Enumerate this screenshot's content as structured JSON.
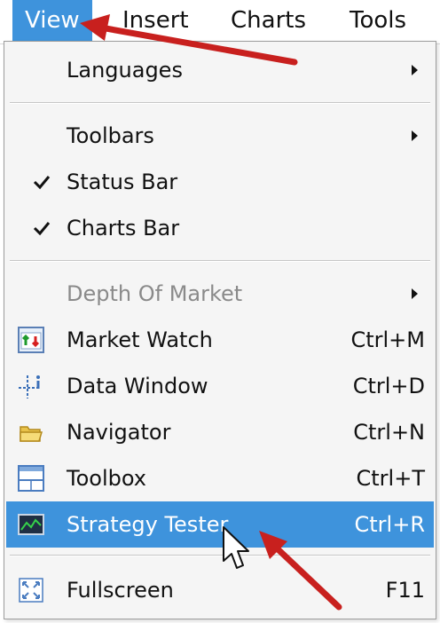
{
  "menubar": {
    "items": [
      {
        "label": "View"
      },
      {
        "label": "Insert"
      },
      {
        "label": "Charts"
      },
      {
        "label": "Tools"
      }
    ]
  },
  "menu": {
    "languages": {
      "label": "Languages"
    },
    "toolbars": {
      "label": "Toolbars"
    },
    "status_bar": {
      "label": "Status Bar",
      "checked": true
    },
    "charts_bar": {
      "label": "Charts Bar",
      "checked": true
    },
    "depth_of_market": {
      "label": "Depth Of Market",
      "disabled": true
    },
    "market_watch": {
      "label": "Market Watch",
      "shortcut": "Ctrl+M",
      "icon": "market-watch-icon"
    },
    "data_window": {
      "label": "Data Window",
      "shortcut": "Ctrl+D",
      "icon": "data-window-icon"
    },
    "navigator": {
      "label": "Navigator",
      "shortcut": "Ctrl+N",
      "icon": "navigator-folder-icon"
    },
    "toolbox": {
      "label": "Toolbox",
      "shortcut": "Ctrl+T",
      "icon": "toolbox-icon"
    },
    "strategy_tester": {
      "label": "Strategy Tester",
      "shortcut": "Ctrl+R",
      "icon": "strategy-tester-icon",
      "highlighted": true
    },
    "fullscreen": {
      "label": "Fullscreen",
      "shortcut": "F11",
      "icon": "fullscreen-icon"
    }
  },
  "colors": {
    "highlight": "#3e93dc",
    "annotation_arrow": "#c8201e"
  }
}
